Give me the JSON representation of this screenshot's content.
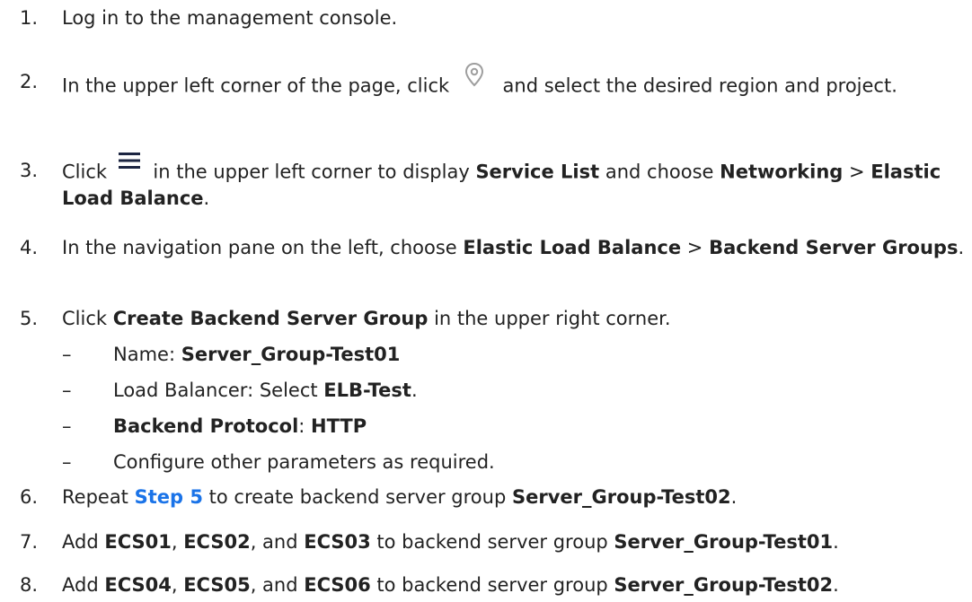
{
  "steps": [
    {
      "num": "1.",
      "text": "Log in to the management console."
    },
    {
      "num": "2.",
      "t1": "In the upper left corner of the page, click ",
      "t2": " and select the desired region and project."
    },
    {
      "num": "3.",
      "t1": "Click ",
      "t2": " in the upper left corner to display ",
      "b1": "Service List",
      "t3": " and choose ",
      "b2": "Networking",
      "t4": " > ",
      "b3": "Elastic Load Balance",
      "t5": "."
    },
    {
      "num": "4.",
      "t1": "In the navigation pane on the left, choose ",
      "b1": "Elastic Load Balance",
      "t2": " > ",
      "b2": "Backend Server Groups",
      "t3": "."
    },
    {
      "num": "5.",
      "t1": "Click ",
      "b1": "Create Backend Server Group",
      "t2": " in the upper right corner."
    },
    {
      "num": "6.",
      "t1": "Repeat ",
      "link": "Step 5",
      "t2": " to create backend server group ",
      "b1": "Server_Group-Test02",
      "t3": "."
    },
    {
      "num": "7.",
      "t1": "Add ",
      "b1": "ECS01",
      "t2": ", ",
      "b2": "ECS02",
      "t3": ", and ",
      "b3": "ECS03",
      "t4": " to backend server group ",
      "b4": "Server_Group-Test01",
      "t5": "."
    },
    {
      "num": "8.",
      "t1": "Add ",
      "b1": "ECS04",
      "t2": ", ",
      "b2": "ECS05",
      "t3": ", and ",
      "b3": "ECS06",
      "t4": " to backend server group ",
      "b4": "Server_Group-Test02",
      "t5": "."
    }
  ],
  "substeps": [
    {
      "dash": "–",
      "t1": "Name: ",
      "b1": "Server_Group-Test01"
    },
    {
      "dash": "–",
      "t1": "Load Balancer: Select ",
      "b1": "ELB-Test",
      "t2": "."
    },
    {
      "dash": "–",
      "b1": "Backend Protocol",
      "t1": ": ",
      "b2": "HTTP"
    },
    {
      "dash": "–",
      "t1": "Configure other parameters as required."
    }
  ],
  "icons": {
    "region": "location-pin-icon",
    "menu": "hamburger-menu-icon"
  },
  "colors": {
    "text": "#222222",
    "link": "#1a73e8",
    "icon_light": "#9e9e9e",
    "icon_dark": "#1c2541"
  }
}
